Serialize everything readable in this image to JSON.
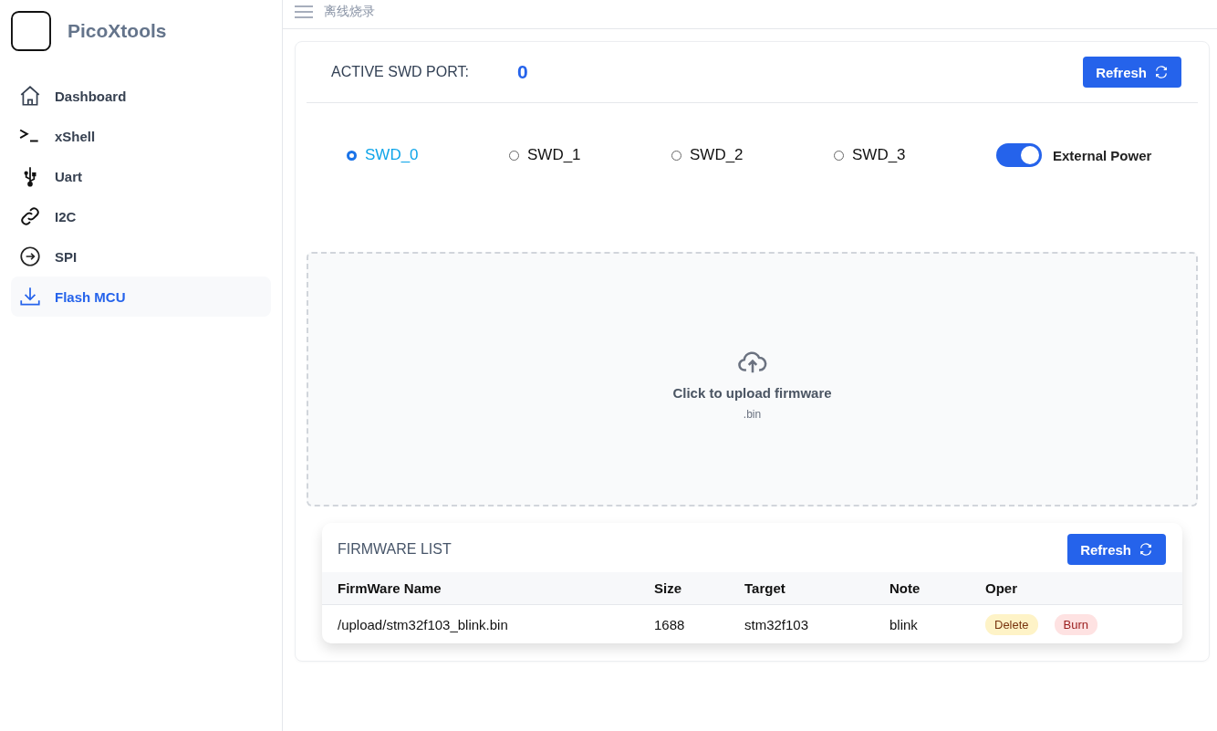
{
  "app": {
    "name": "PicoXtools"
  },
  "sidebar": {
    "items": [
      {
        "label": "Dashboard",
        "kind": "home",
        "selected": false
      },
      {
        "label": "xShell",
        "kind": "terminal",
        "selected": false
      },
      {
        "label": "Uart",
        "kind": "usb",
        "selected": false
      },
      {
        "label": "I2C",
        "kind": "link",
        "selected": false
      },
      {
        "label": "SPI",
        "kind": "arrow",
        "selected": false
      },
      {
        "label": "Flash MCU",
        "kind": "download",
        "selected": true
      }
    ]
  },
  "header": {
    "title": "离线烧录"
  },
  "port": {
    "label": "ACTIVE SWD PORT:",
    "value": "0",
    "refresh": "Refresh"
  },
  "ports": [
    {
      "label": "SWD_0",
      "selected": true
    },
    {
      "label": "SWD_1",
      "selected": false
    },
    {
      "label": "SWD_2",
      "selected": false
    },
    {
      "label": "SWD_3",
      "selected": false
    }
  ],
  "external_power": {
    "label": "External Power",
    "on": true
  },
  "upload": {
    "title": "Click to upload firmware",
    "hint": ".bin"
  },
  "firmware": {
    "title": "FIRMWARE LIST",
    "refresh": "Refresh",
    "columns": [
      "FirmWare Name",
      "Size",
      "Target",
      "Note",
      "Oper"
    ],
    "rows": [
      {
        "name": "/upload/stm32f103_blink.bin",
        "size": "1688",
        "target": "stm32f103",
        "note": "blink",
        "actions": [
          {
            "label": "Delete",
            "kind": "warn"
          },
          {
            "label": "Burn",
            "kind": "danger"
          }
        ]
      }
    ]
  }
}
